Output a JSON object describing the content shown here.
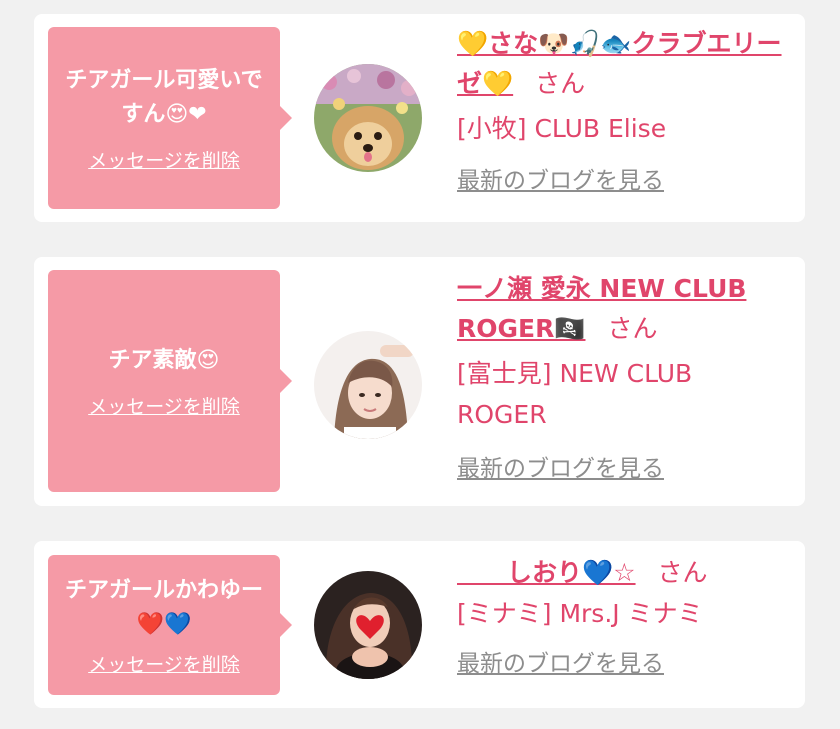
{
  "messages": [
    {
      "text": "チアガール可愛いですん😍❤",
      "delete_label": "メッセージを削除",
      "sender_name": "💛さな🐶🎣🐟クラブエリーゼ💛",
      "suffix": "さん",
      "shop": "[小牧] CLUB Elise",
      "blog_link": "最新のブログを見る"
    },
    {
      "text": "チア素敵😍",
      "delete_label": "メッセージを削除",
      "sender_name": "一ノ瀬 愛永 NEW CLUB ROGER🏴‍☠️",
      "suffix": "さん",
      "shop": "[富士見] NEW CLUB ROGER",
      "blog_link": "最新のブログを見る"
    },
    {
      "text": "チアガールかわゆー❤️💙",
      "delete_label": "メッセージを削除",
      "sender_name": "　　しおり💙☆",
      "suffix": "さん",
      "shop": "[ミナミ] Mrs.J ミナミ",
      "blog_link": "最新のブログを見る"
    }
  ],
  "colors": {
    "page_bg": "#f1f1f1",
    "bubble": "#f59aa6",
    "accent_pink": "#e0456b",
    "link_gray": "#8d8d8d"
  }
}
